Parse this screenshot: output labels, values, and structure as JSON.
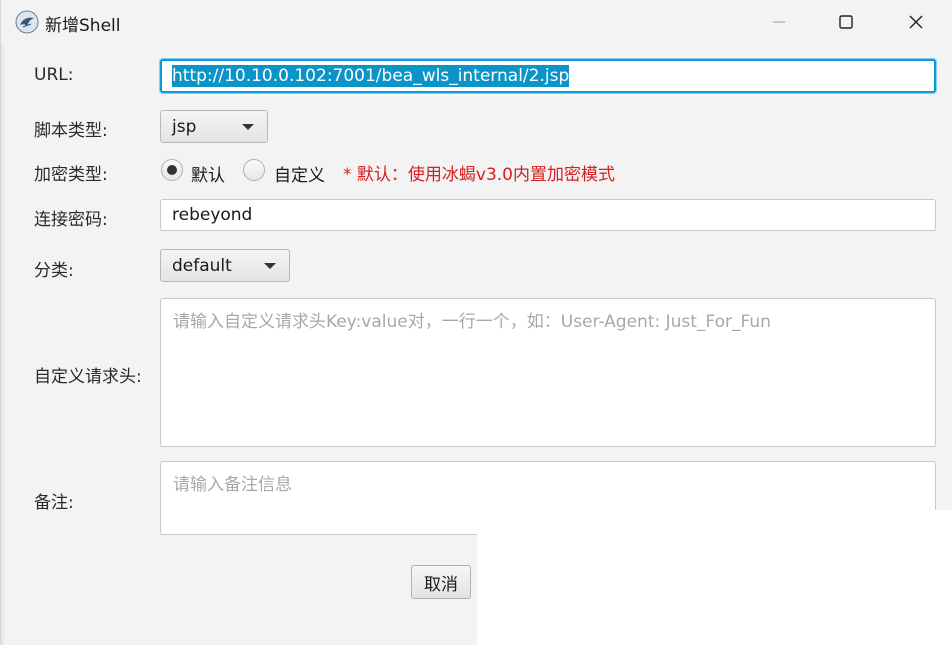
{
  "window": {
    "title": "新增Shell"
  },
  "form": {
    "url_label": "URL:",
    "url_value": "http://10.10.0.102:7001/bea_wls_internal/2.jsp",
    "script_type_label": "脚本类型:",
    "script_type_value": "jsp",
    "encrypt_type_label": "加密类型:",
    "encrypt_options": [
      {
        "label": "默认",
        "selected": true
      },
      {
        "label": "自定义",
        "selected": false
      }
    ],
    "encrypt_hint": "* 默认：使用冰蝎v3.0内置加密模式",
    "password_label": "连接密码:",
    "password_value": "rebeyond",
    "category_label": "分类:",
    "category_value": "default",
    "headers_label": "自定义请求头:",
    "headers_placeholder": "请输入自定义请求头Key:value对，一行一个，如：User-Agent: Just_For_Fun",
    "notes_label": "备注:",
    "notes_placeholder": "请输入备注信息",
    "cancel_label": "取消"
  },
  "colors": {
    "focus_border": "#0a9bd9",
    "selection": "#0a94c8",
    "hint_red": "#d42020"
  }
}
